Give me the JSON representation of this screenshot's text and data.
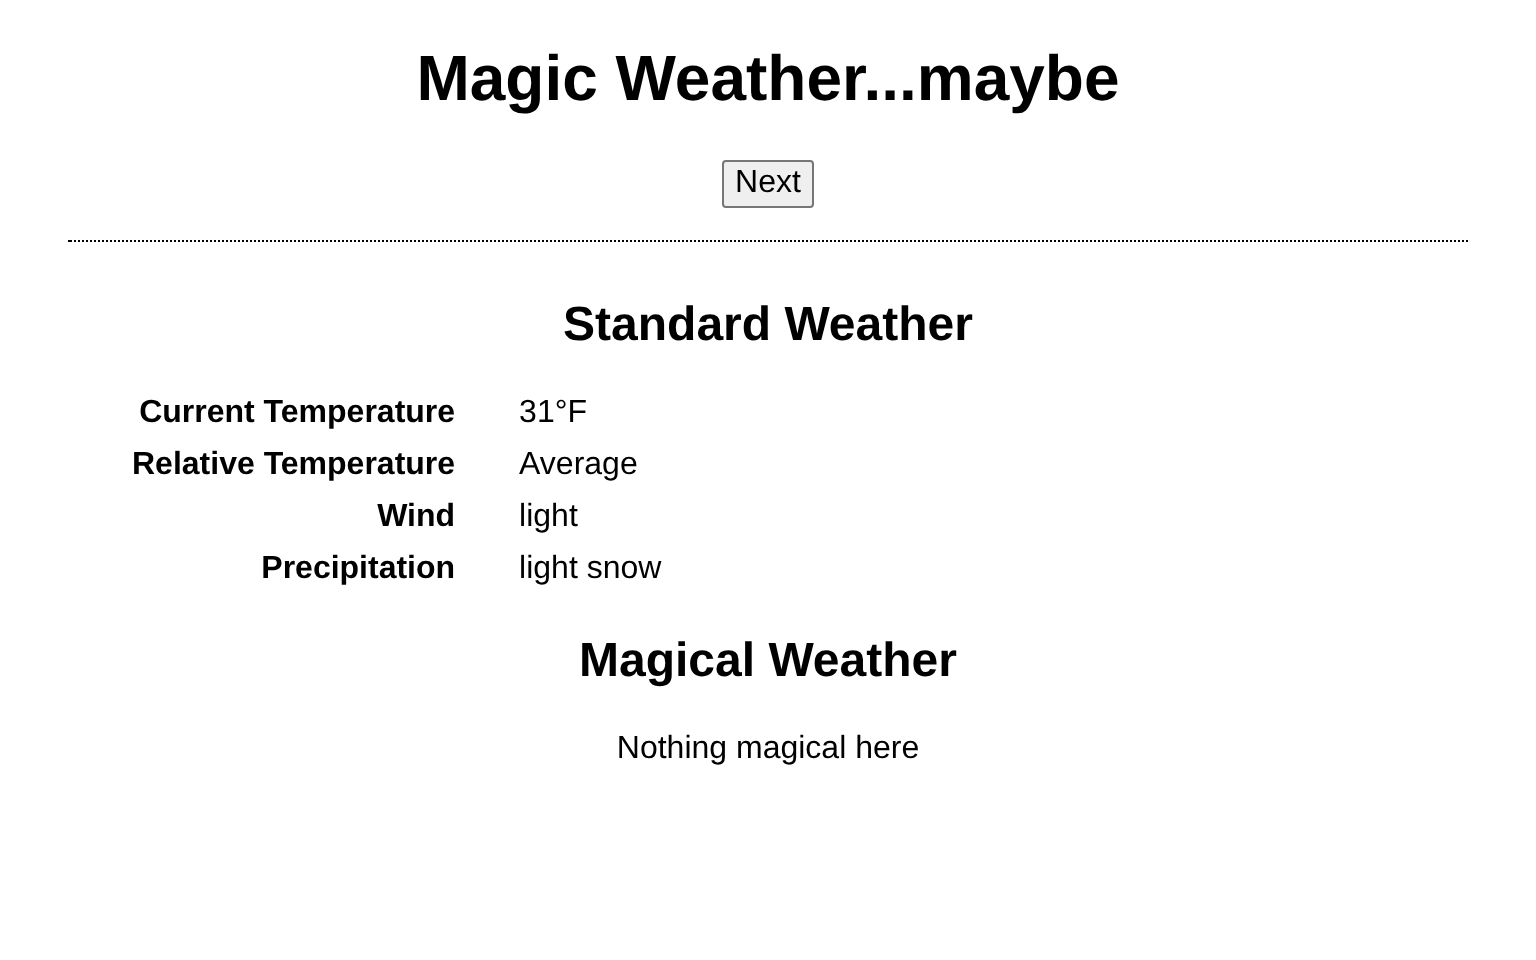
{
  "title": "Magic Weather...maybe",
  "next_button": "Next",
  "standard_weather": {
    "heading": "Standard Weather",
    "rows": [
      {
        "label": "Current Temperature",
        "value": "31°F"
      },
      {
        "label": "Relative Temperature",
        "value": "Average"
      },
      {
        "label": "Wind",
        "value": "light"
      },
      {
        "label": "Precipitation",
        "value": "light snow"
      }
    ]
  },
  "magical_weather": {
    "heading": "Magical Weather",
    "text": "Nothing magical here"
  }
}
